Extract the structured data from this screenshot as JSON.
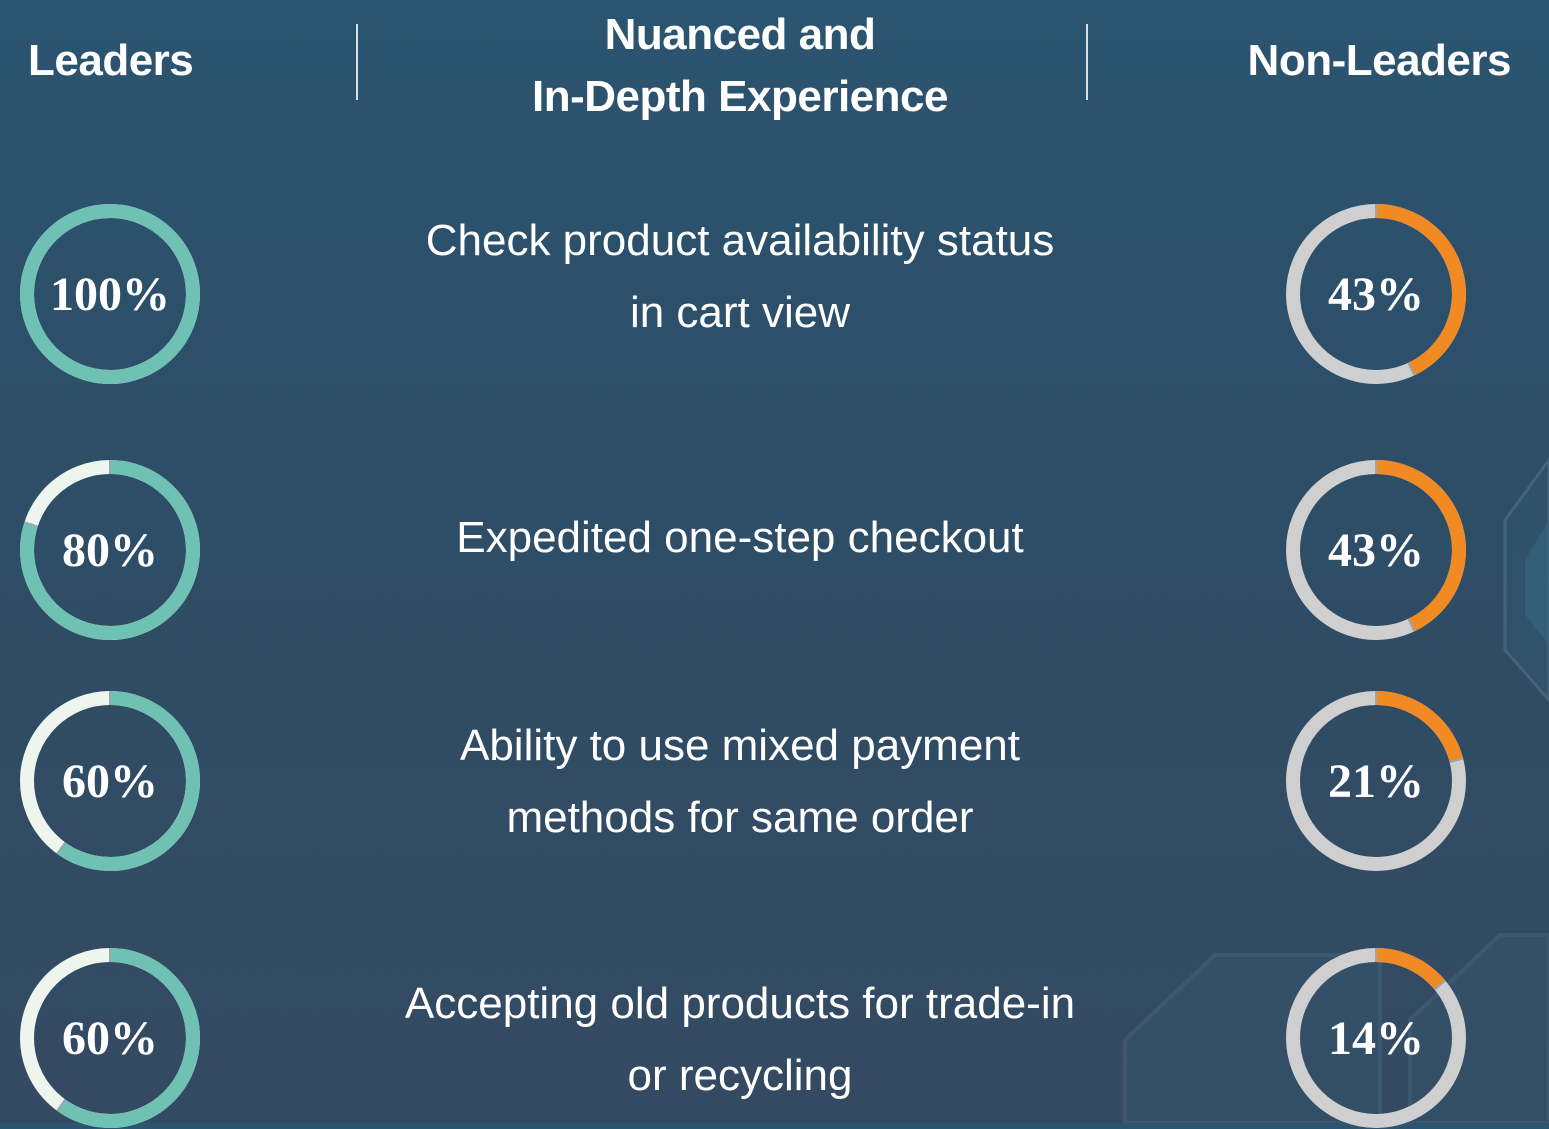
{
  "headers": {
    "left": "Leaders",
    "middle_line1": "Nuanced and",
    "middle_line2": "In-Depth Experience",
    "right": "Non-Leaders"
  },
  "colors": {
    "leaders_fill": "#6fc1b3",
    "leaders_track": "#eef5ee",
    "non_leaders_fill": "#f28a24",
    "non_leaders_track": "#cfcfcf"
  },
  "rows": [
    {
      "line1": "Check product availability status",
      "line2": "in cart view",
      "leaders_label": "100%",
      "non_leaders_label": "43%"
    },
    {
      "line1": "Expedited one-step checkout",
      "line2": "",
      "leaders_label": "80%",
      "non_leaders_label": "43%"
    },
    {
      "line1": "Ability to use mixed payment",
      "line2": "methods for same order",
      "leaders_label": "60%",
      "non_leaders_label": "21%"
    },
    {
      "line1": "Accepting old products for trade-in",
      "line2": "or recycling",
      "leaders_label": "60%",
      "non_leaders_label": "14%"
    }
  ],
  "chart_data": {
    "type": "donut",
    "categories": [
      "Check product availability status in cart view",
      "Expedited one-step checkout",
      "Ability to use mixed payment methods for same order",
      "Accepting old products for trade-in or recycling"
    ],
    "series": [
      {
        "name": "Leaders",
        "values": [
          100,
          80,
          60,
          60
        ]
      },
      {
        "name": "Non-Leaders",
        "values": [
          43,
          43,
          21,
          14
        ]
      }
    ],
    "unit": "%"
  }
}
